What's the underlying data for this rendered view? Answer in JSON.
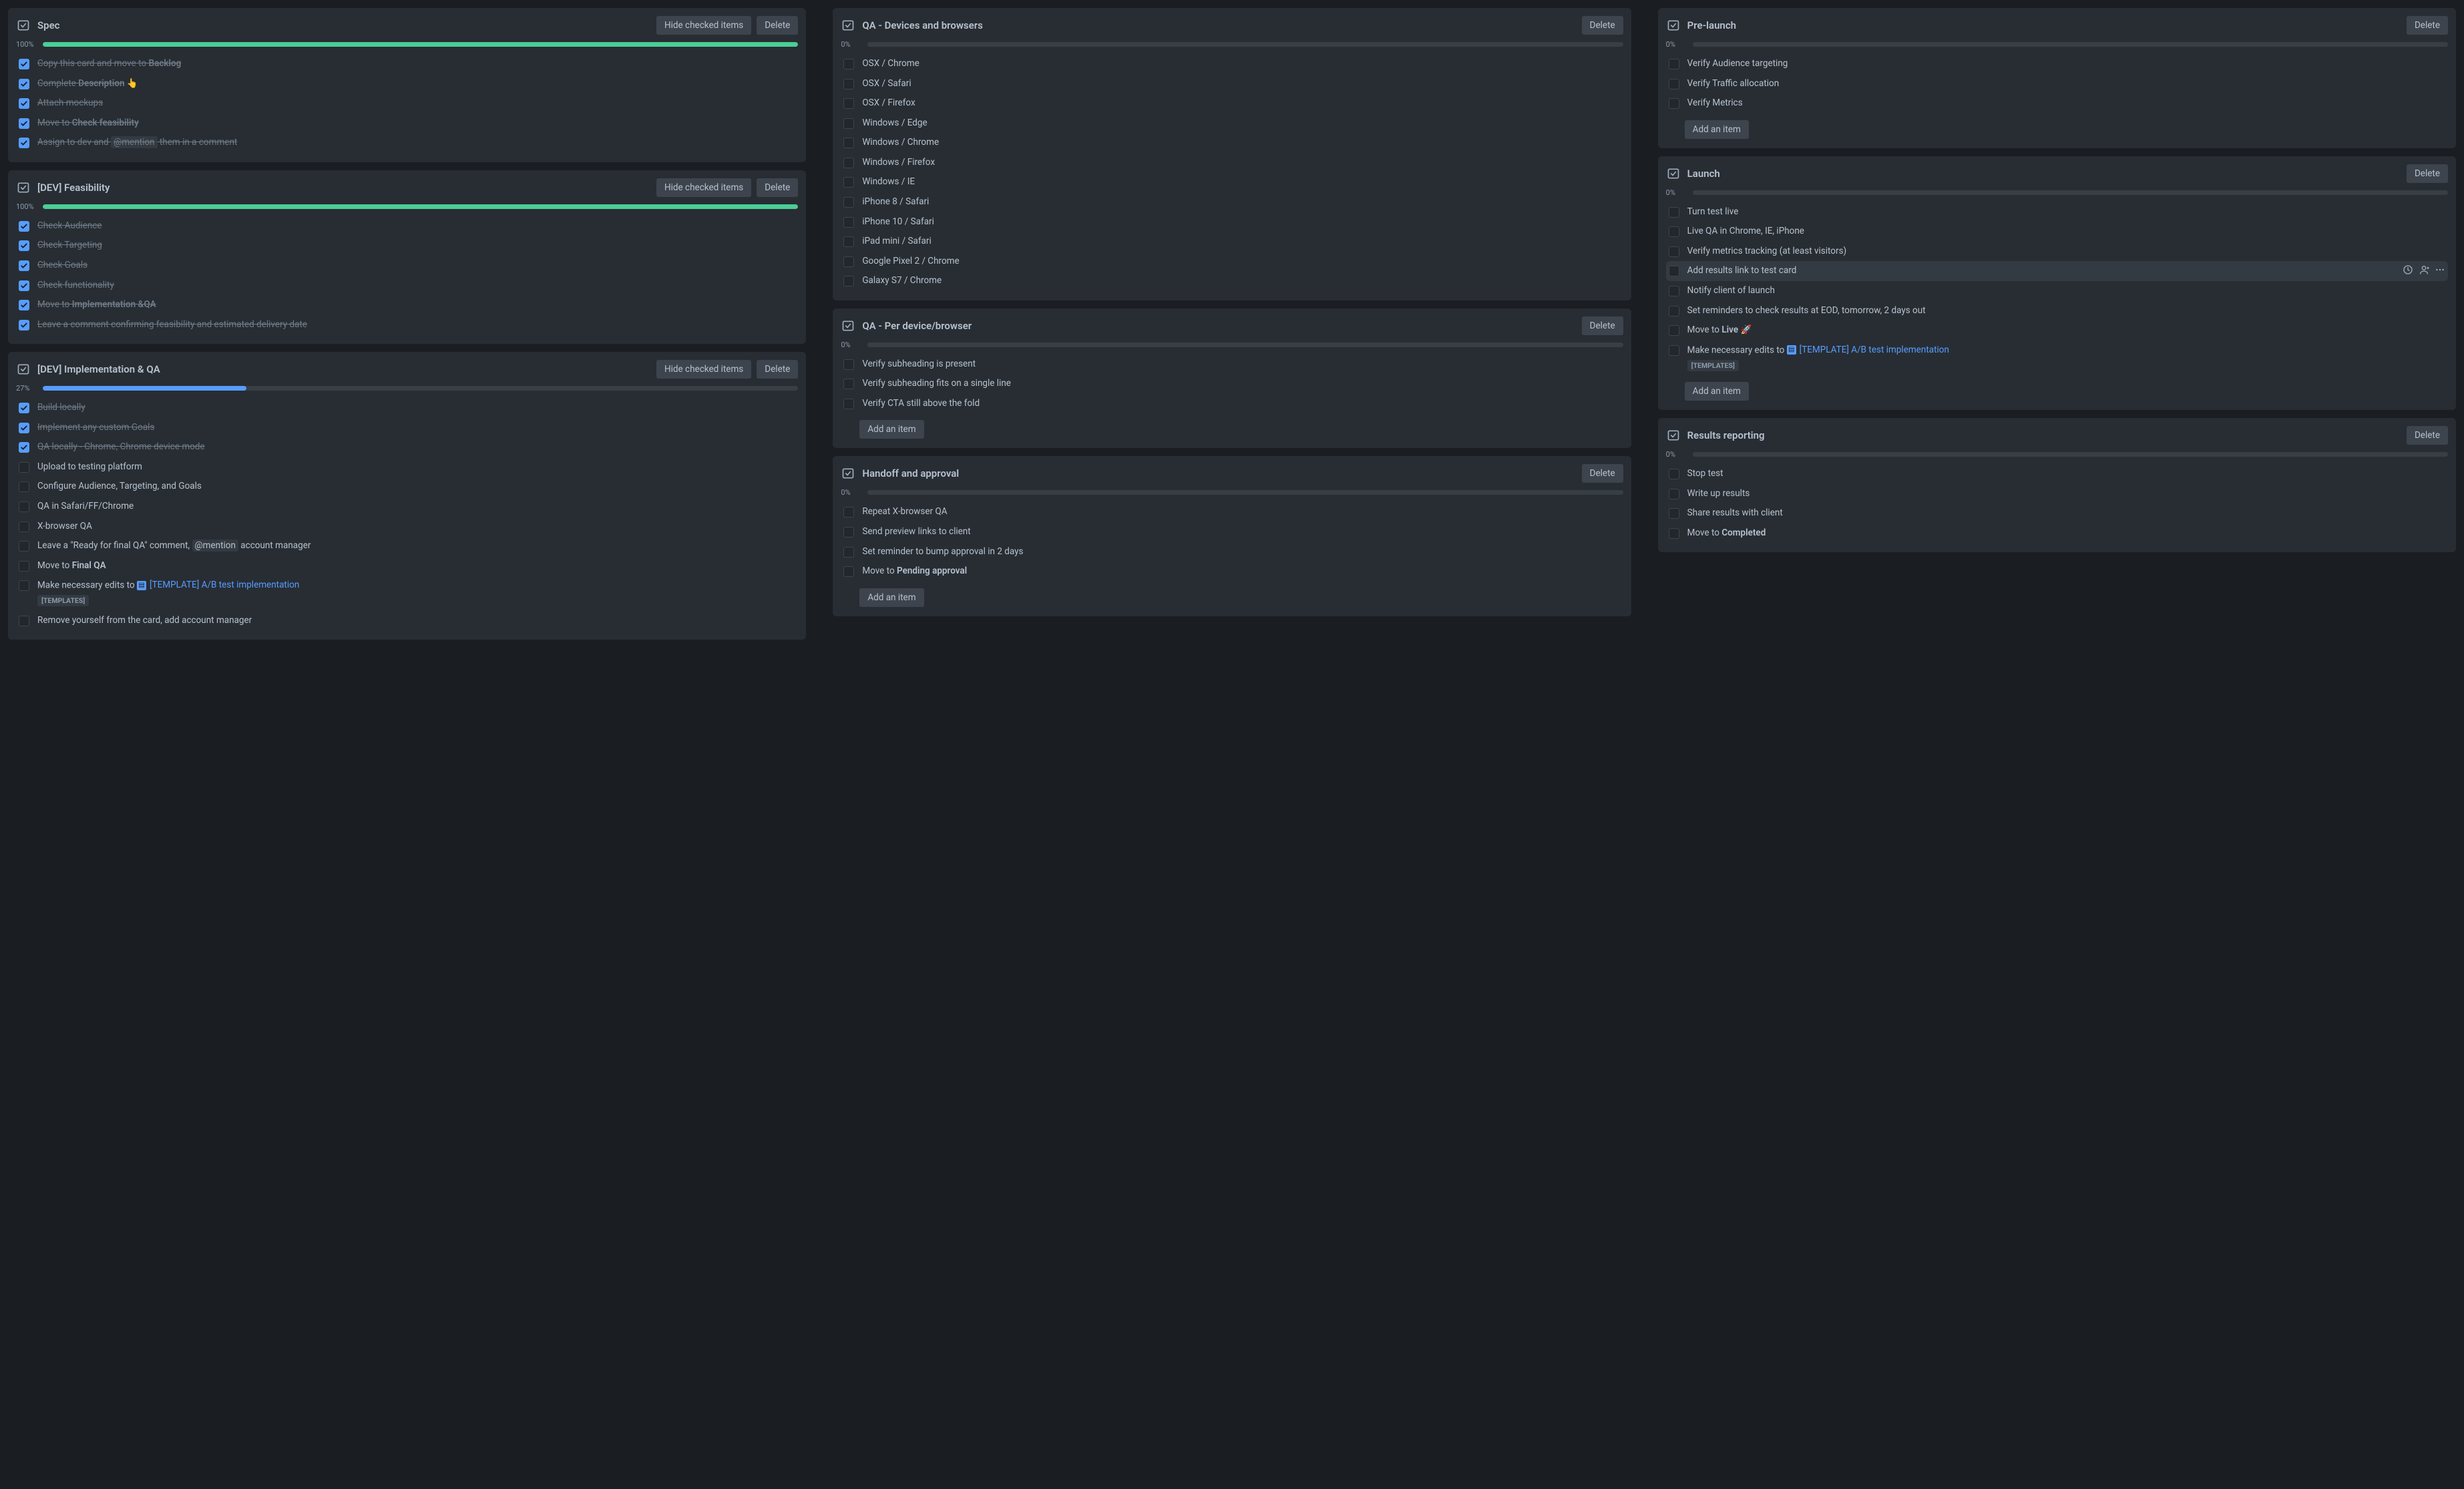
{
  "btn_hide": "Hide checked items",
  "btn_delete": "Delete",
  "btn_add": "Add an item",
  "checklists": [
    {
      "col": 0,
      "id": "spec",
      "title": "Spec",
      "pct": "100%",
      "fill": 100,
      "color": "green",
      "hide": true,
      "items": [
        {
          "done": true,
          "seg": [
            {
              "t": "Copy this card and move to ",
              "s": true
            },
            {
              "t": "Backlog",
              "s": true,
              "b": true
            }
          ]
        },
        {
          "done": true,
          "seg": [
            {
              "t": "Complete ",
              "s": true
            },
            {
              "t": "Description",
              "s": true,
              "b": true
            },
            {
              "t": " 👆",
              "s": false
            }
          ]
        },
        {
          "done": true,
          "seg": [
            {
              "t": "Attach mockups",
              "s": true
            }
          ]
        },
        {
          "done": true,
          "seg": [
            {
              "t": "Move to ",
              "s": true
            },
            {
              "t": "Check feasibility",
              "s": true,
              "b": true
            }
          ]
        },
        {
          "done": true,
          "seg": [
            {
              "t": "Assign to dev and ",
              "s": true
            },
            {
              "t": "@mention",
              "s": true,
              "m": true
            },
            {
              "t": " them in a comment",
              "s": true
            }
          ]
        }
      ]
    },
    {
      "col": 0,
      "id": "dev-feasibility",
      "title": "[DEV] Feasibility",
      "pct": "100%",
      "fill": 100,
      "color": "green",
      "hide": true,
      "items": [
        {
          "done": true,
          "seg": [
            {
              "t": "Check Audience",
              "s": true
            }
          ]
        },
        {
          "done": true,
          "seg": [
            {
              "t": "Check Targeting",
              "s": true
            }
          ]
        },
        {
          "done": true,
          "seg": [
            {
              "t": "Check Goals",
              "s": true
            }
          ]
        },
        {
          "done": true,
          "seg": [
            {
              "t": "Check functionality",
              "s": true
            }
          ]
        },
        {
          "done": true,
          "seg": [
            {
              "t": "Move to ",
              "s": true
            },
            {
              "t": "Implementation &QA",
              "s": true,
              "b": true
            }
          ]
        },
        {
          "done": true,
          "seg": [
            {
              "t": "Leave a comment confirming feasibility and estimated delivery date",
              "s": true
            }
          ]
        }
      ]
    },
    {
      "col": 0,
      "id": "dev-impl",
      "title": "[DEV] Implementation & QA",
      "pct": "27%",
      "fill": 27,
      "color": "blue",
      "hide": true,
      "items": [
        {
          "done": true,
          "seg": [
            {
              "t": "Build locally",
              "s": true
            }
          ]
        },
        {
          "done": true,
          "seg": [
            {
              "t": "Implement any custom Goals",
              "s": true
            }
          ]
        },
        {
          "done": true,
          "seg": [
            {
              "t": "QA locally - Chrome, Chrome device mode",
              "s": true
            }
          ]
        },
        {
          "done": false,
          "seg": [
            {
              "t": "Upload to testing platform"
            }
          ]
        },
        {
          "done": false,
          "seg": [
            {
              "t": "Configure Audience, Targeting, and Goals"
            }
          ]
        },
        {
          "done": false,
          "seg": [
            {
              "t": "QA in Safari/FF/Chrome"
            }
          ]
        },
        {
          "done": false,
          "seg": [
            {
              "t": "X-browser QA"
            }
          ]
        },
        {
          "done": false,
          "seg": [
            {
              "t": "Leave a \"Ready for final QA\" comment, "
            },
            {
              "t": "@mention",
              "m": true
            },
            {
              "t": " account manager"
            }
          ]
        },
        {
          "done": false,
          "seg": [
            {
              "t": "Move to "
            },
            {
              "t": "Final QA",
              "b": true
            }
          ]
        },
        {
          "done": false,
          "seg": [
            {
              "t": "Make necessary edits to "
            },
            {
              "t": "[TEMPLATE] A/B test implementation",
              "link": true,
              "chip": true
            }
          ],
          "badge": "[TEMPLATES]"
        },
        {
          "done": false,
          "seg": [
            {
              "t": "Remove yourself from the card, add account manager"
            }
          ]
        }
      ]
    },
    {
      "col": 1,
      "id": "qa-devices",
      "title": "QA - Devices and browsers",
      "pct": "0%",
      "fill": 0,
      "color": "green",
      "hide": false,
      "items": [
        {
          "done": false,
          "seg": [
            {
              "t": "OSX / Chrome"
            }
          ]
        },
        {
          "done": false,
          "seg": [
            {
              "t": "OSX / Safari"
            }
          ]
        },
        {
          "done": false,
          "seg": [
            {
              "t": "OSX / Firefox"
            }
          ]
        },
        {
          "done": false,
          "seg": [
            {
              "t": "Windows / Edge"
            }
          ]
        },
        {
          "done": false,
          "seg": [
            {
              "t": "Windows / Chrome"
            }
          ]
        },
        {
          "done": false,
          "seg": [
            {
              "t": "Windows / Firefox"
            }
          ]
        },
        {
          "done": false,
          "seg": [
            {
              "t": "Windows / IE"
            }
          ]
        },
        {
          "done": false,
          "seg": [
            {
              "t": "iPhone 8 / Safari"
            }
          ]
        },
        {
          "done": false,
          "seg": [
            {
              "t": "iPhone 10 / Safari"
            }
          ]
        },
        {
          "done": false,
          "seg": [
            {
              "t": "iPad mini / Safari"
            }
          ]
        },
        {
          "done": false,
          "seg": [
            {
              "t": "Google Pixel 2 / Chrome"
            }
          ]
        },
        {
          "done": false,
          "seg": [
            {
              "t": "Galaxy S7 / Chrome"
            }
          ]
        }
      ]
    },
    {
      "col": 1,
      "id": "qa-per",
      "title": "QA - Per device/browser",
      "pct": "0%",
      "fill": 0,
      "color": "green",
      "hide": false,
      "add": true,
      "items": [
        {
          "done": false,
          "seg": [
            {
              "t": "Verify subheading is present"
            }
          ]
        },
        {
          "done": false,
          "seg": [
            {
              "t": "Verify subheading fits on a single line"
            }
          ]
        },
        {
          "done": false,
          "seg": [
            {
              "t": "Verify CTA still above the fold"
            }
          ]
        }
      ]
    },
    {
      "col": 1,
      "id": "handoff",
      "title": "Handoff and approval",
      "pct": "0%",
      "fill": 0,
      "color": "green",
      "hide": false,
      "add": true,
      "items": [
        {
          "done": false,
          "seg": [
            {
              "t": "Repeat X-browser QA"
            }
          ]
        },
        {
          "done": false,
          "seg": [
            {
              "t": "Send preview links to client"
            }
          ]
        },
        {
          "done": false,
          "seg": [
            {
              "t": "Set reminder to bump approval in 2 days"
            }
          ]
        },
        {
          "done": false,
          "seg": [
            {
              "t": "Move to "
            },
            {
              "t": "Pending approval",
              "b": true
            }
          ]
        }
      ]
    },
    {
      "col": 2,
      "id": "prelaunch",
      "title": "Pre-launch",
      "pct": "0%",
      "fill": 0,
      "color": "green",
      "hide": false,
      "add": true,
      "items": [
        {
          "done": false,
          "seg": [
            {
              "t": "Verify Audience targeting"
            }
          ]
        },
        {
          "done": false,
          "seg": [
            {
              "t": "Verify Traffic allocation"
            }
          ]
        },
        {
          "done": false,
          "seg": [
            {
              "t": "Verify Metrics"
            }
          ]
        }
      ]
    },
    {
      "col": 2,
      "id": "launch",
      "title": "Launch",
      "pct": "0%",
      "fill": 0,
      "color": "green",
      "hide": false,
      "add": true,
      "items": [
        {
          "done": false,
          "seg": [
            {
              "t": "Turn test live"
            }
          ]
        },
        {
          "done": false,
          "seg": [
            {
              "t": "Live QA in Chrome, IE, iPhone"
            }
          ]
        },
        {
          "done": false,
          "seg": [
            {
              "t": "Verify metrics tracking (at least visitors)"
            }
          ]
        },
        {
          "done": false,
          "hovered": true,
          "seg": [
            {
              "t": "Add results link to test card"
            }
          ]
        },
        {
          "done": false,
          "seg": [
            {
              "t": "Notify client of launch"
            }
          ]
        },
        {
          "done": false,
          "seg": [
            {
              "t": "Set reminders to check results at EOD, tomorrow, 2 days out"
            }
          ]
        },
        {
          "done": false,
          "seg": [
            {
              "t": "Move to "
            },
            {
              "t": "Live",
              "b": true
            },
            {
              "t": " 🚀"
            }
          ]
        },
        {
          "done": false,
          "seg": [
            {
              "t": "Make necessary edits to "
            },
            {
              "t": "[TEMPLATE] A/B test implementation",
              "link": true,
              "chip": true
            }
          ],
          "badge": "[TEMPLATES]"
        }
      ]
    },
    {
      "col": 2,
      "id": "results",
      "title": "Results reporting",
      "pct": "0%",
      "fill": 0,
      "color": "green",
      "hide": false,
      "items": [
        {
          "done": false,
          "seg": [
            {
              "t": "Stop test"
            }
          ]
        },
        {
          "done": false,
          "seg": [
            {
              "t": "Write up results"
            }
          ]
        },
        {
          "done": false,
          "seg": [
            {
              "t": "Share results with client"
            }
          ]
        },
        {
          "done": false,
          "seg": [
            {
              "t": "Move to "
            },
            {
              "t": "Completed",
              "b": true
            }
          ]
        }
      ]
    }
  ]
}
